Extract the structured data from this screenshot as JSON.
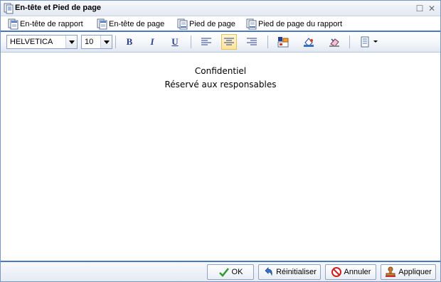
{
  "window": {
    "title": "En-tête et Pied de page",
    "maximize_symbol": "☐",
    "close_symbol": "✕"
  },
  "tabs": [
    {
      "label": "En-tête de rapport",
      "icon": "page-header-icon"
    },
    {
      "label": "En-tête de page",
      "icon": "page-header-icon"
    },
    {
      "label": "Pied de page",
      "icon": "page-footer-icon"
    },
    {
      "label": "Pied de page du rapport",
      "icon": "page-footer-icon"
    }
  ],
  "toolbar": {
    "font_family": "HELVETICA",
    "font_size": "10",
    "bold": "B",
    "italic": "I",
    "underline": "U",
    "active_alignment": "center",
    "colors": {
      "accent": "#4a77c0",
      "icon_blue": "#2a3f8f"
    }
  },
  "editor": {
    "lines": [
      "Confidentiel",
      "Réservé aux responsables"
    ]
  },
  "buttons": {
    "ok": "OK",
    "reset": "Réinitialiser",
    "cancel": "Annuler",
    "apply": "Appliquer"
  }
}
